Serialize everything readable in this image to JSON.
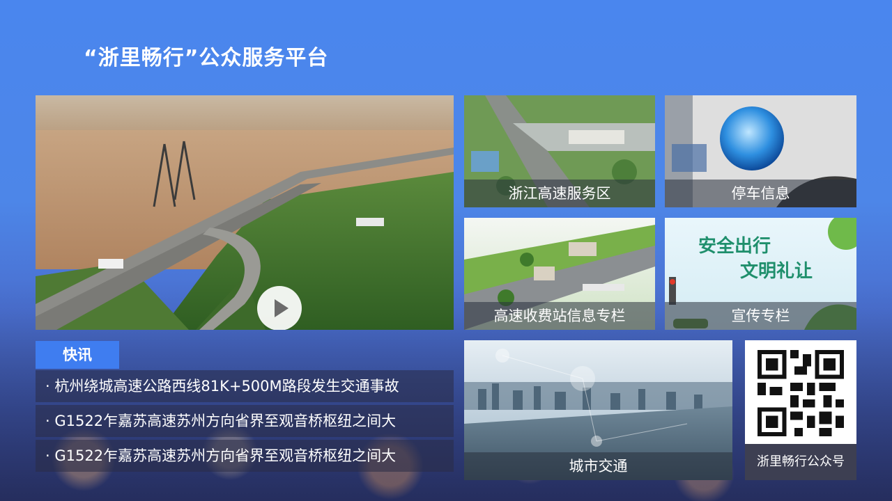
{
  "page": {
    "title": "“浙里畅行”公众服务平台"
  },
  "tiles": {
    "service_area": "浙江高速服务区",
    "parking": "停车信息",
    "toll_station": "高速收费站信息专栏",
    "publicity": "宣传专栏",
    "publicity_banner_line1": "安全出行",
    "publicity_banner_line2": "文明礼让",
    "city_traffic": "城市交通"
  },
  "news": {
    "header": "快讯",
    "items": [
      "· 杭州绕城高速公路西线81K+500M路段发生交通事故",
      "· G1522乍嘉苏高速苏州方向省界至观音桥枢纽之间大",
      "· G1522乍嘉苏高速苏州方向省界至观音桥枢纽之间大"
    ]
  },
  "qr": {
    "caption": "浙里畅行公众号"
  },
  "icons": [
    "play-icon",
    "qr-code-icon",
    "globe-icon",
    "wifi-icon"
  ],
  "colors": {
    "accent": "#3f7df0",
    "caption_bg": "rgba(40,48,60,.55)",
    "publicity_text": "#1f8f6c"
  }
}
